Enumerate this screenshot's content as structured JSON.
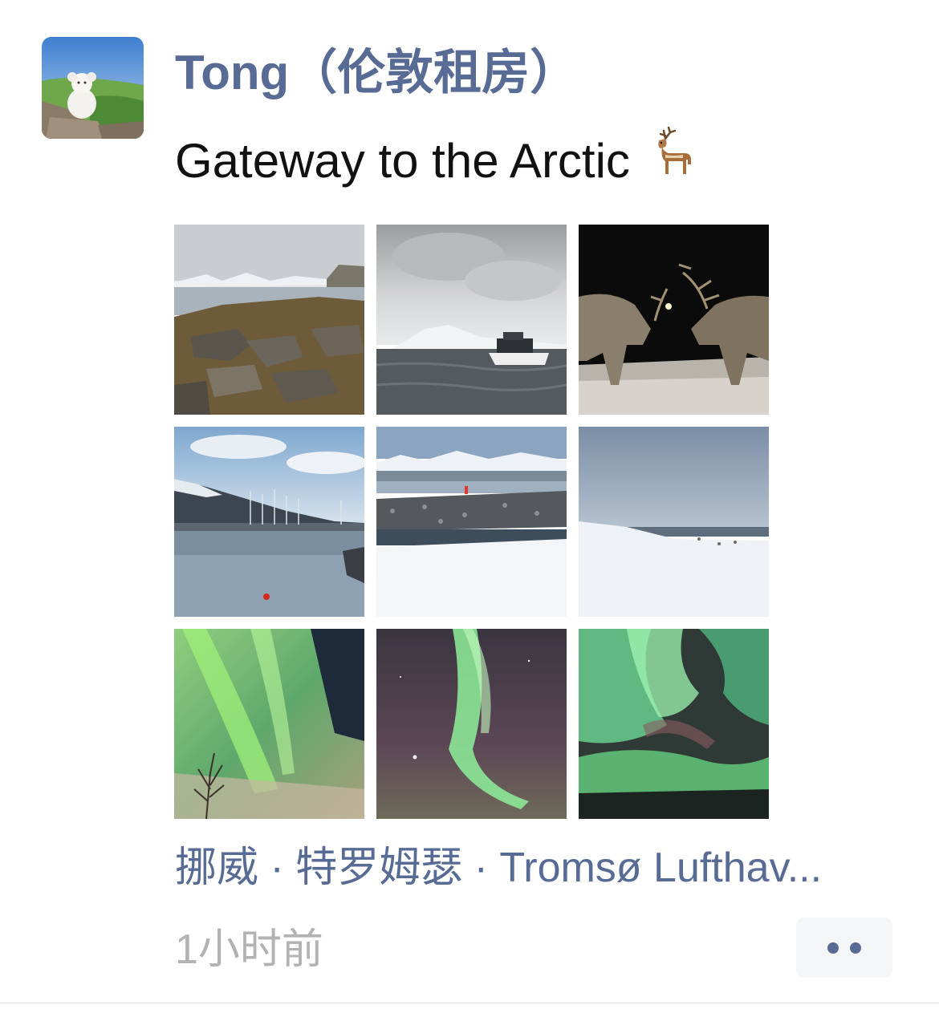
{
  "post": {
    "author": "Tong（伦敦租房）",
    "text": "Gateway to the Arctic",
    "text_emoji_icon": "deer-icon",
    "photos": [
      {
        "icon": "coastline-rocks-photo"
      },
      {
        "icon": "boat-storm-photo"
      },
      {
        "icon": "reindeer-photo"
      },
      {
        "icon": "harbor-mountains-photo"
      },
      {
        "icon": "snowy-shore-photo"
      },
      {
        "icon": "snow-field-photo"
      },
      {
        "icon": "aurora-tree-photo"
      },
      {
        "icon": "aurora-arc-photo"
      },
      {
        "icon": "aurora-sky-photo"
      }
    ],
    "location": "挪威 · 特罗姆瑟 · Tromsø Lufthav...",
    "timestamp": "1小时前"
  },
  "colors": {
    "link": "#576b95",
    "text": "#111111",
    "muted": "#b2b2b2",
    "button_bg": "#f5f6f8"
  }
}
